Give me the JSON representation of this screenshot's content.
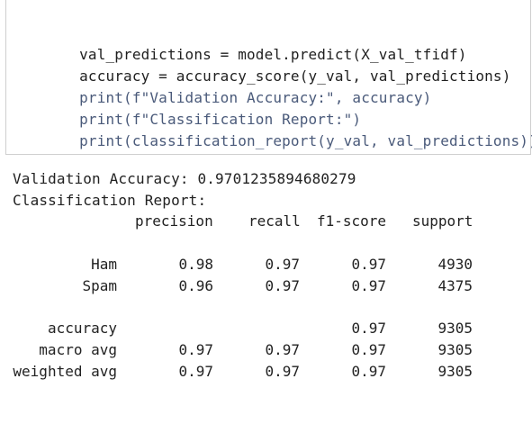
{
  "code_cell": {
    "lines": [
      "val_predictions = model.predict(X_val_tfidf)",
      "accuracy = accuracy_score(y_val, val_predictions)",
      "print(f\"Validation Accuracy:\", accuracy)",
      "print(f\"Classification Report:\")",
      "print(classification_report(y_val, val_predictions))"
    ]
  },
  "output": {
    "accuracy_line": "Validation Accuracy: 0.9701235894680279",
    "report_title": "Classification Report:",
    "headers": [
      "precision",
      "recall",
      "f1-score",
      "support"
    ],
    "rows": [
      {
        "label": "Ham",
        "precision": "0.98",
        "recall": "0.97",
        "f1": "0.97",
        "support": "4930"
      },
      {
        "label": "Spam",
        "precision": "0.96",
        "recall": "0.97",
        "f1": "0.97",
        "support": "4375"
      },
      {
        "label": "accuracy",
        "precision": "",
        "recall": "",
        "f1": "0.97",
        "support": "9305"
      },
      {
        "label": "macro avg",
        "precision": "0.97",
        "recall": "0.97",
        "f1": "0.97",
        "support": "9305"
      },
      {
        "label": "weighted avg",
        "precision": "0.97",
        "recall": "0.97",
        "f1": "0.97",
        "support": "9305"
      }
    ]
  }
}
